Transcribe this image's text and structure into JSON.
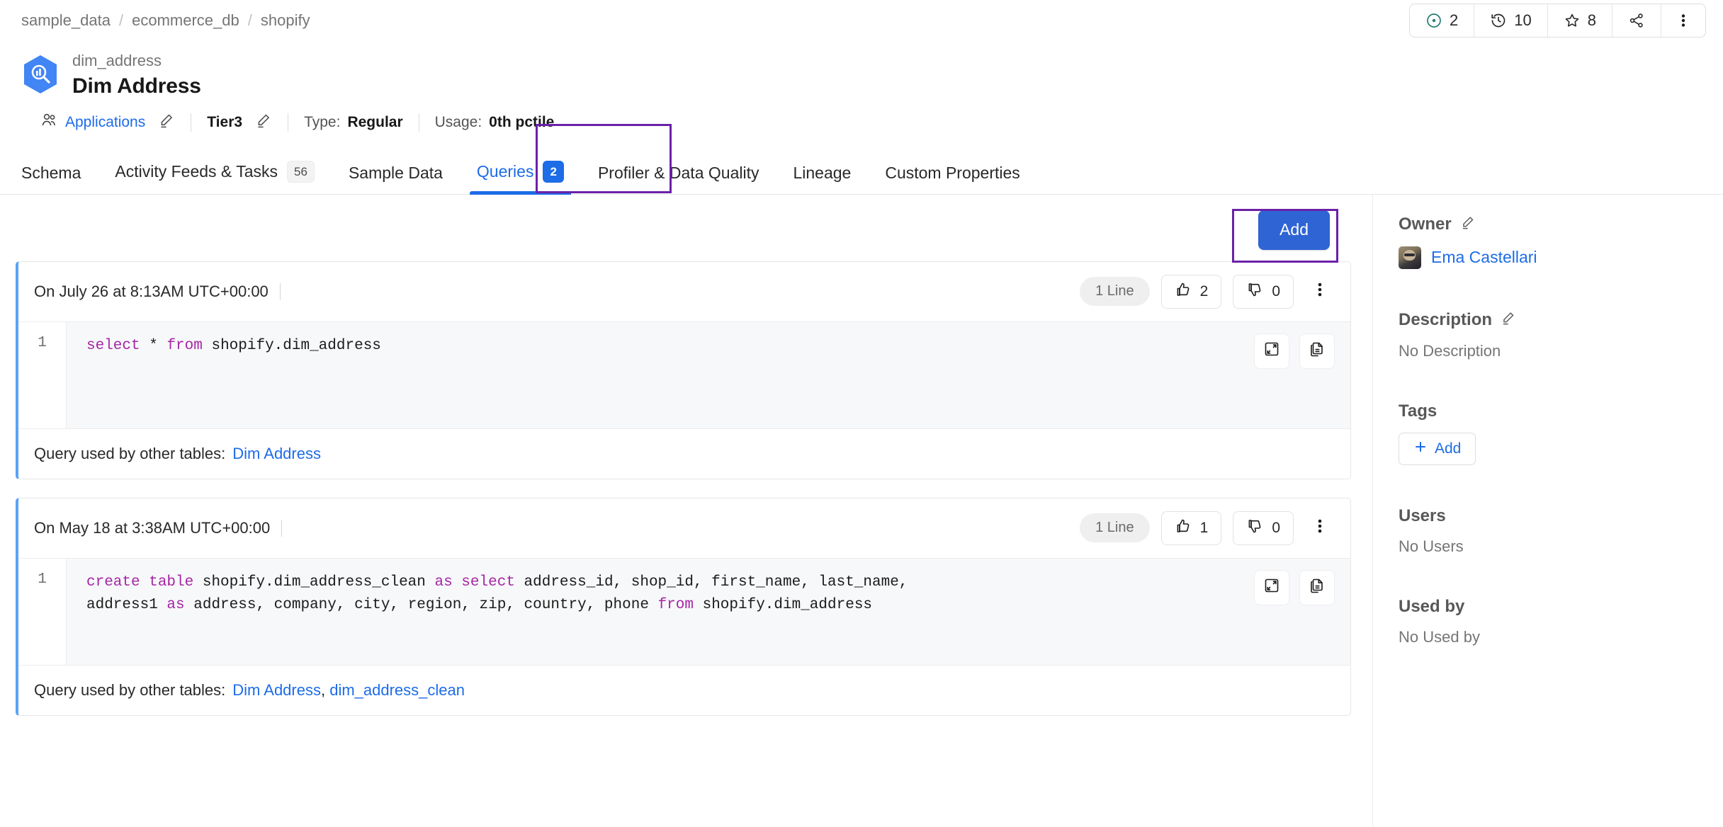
{
  "breadcrumb": {
    "items": [
      "sample_data",
      "ecommerce_db",
      "shopify"
    ],
    "separator": "/"
  },
  "header_actions": {
    "announcement": {
      "icon": "target-icon",
      "count": "2"
    },
    "version": {
      "icon": "history-icon",
      "count": "10"
    },
    "followers": {
      "icon": "star-icon",
      "count": "8"
    },
    "share": {
      "icon": "share-icon"
    },
    "more": {
      "icon": "kebab-menu-icon"
    }
  },
  "entity": {
    "logo_icon": "bigquery-logo-icon",
    "fqn": "dim_address",
    "display_name": "Dim Address",
    "meta": {
      "owner_icon": "team-icon",
      "owner": "Applications",
      "tier": "Tier3",
      "type_label": "Type:",
      "type_value": "Regular",
      "usage_label": "Usage:",
      "usage_value": "0th pctile",
      "edit_icon": "pencil-icon"
    }
  },
  "tabs": [
    {
      "label": "Schema",
      "count": null,
      "active": false
    },
    {
      "label": "Activity Feeds & Tasks",
      "count": "56",
      "active": false
    },
    {
      "label": "Sample Data",
      "count": null,
      "active": false
    },
    {
      "label": "Queries",
      "count": "2",
      "active": true
    },
    {
      "label": "Profiler & Data Quality",
      "count": null,
      "active": false
    },
    {
      "label": "Lineage",
      "count": null,
      "active": false
    },
    {
      "label": "Custom Properties",
      "count": null,
      "active": false
    }
  ],
  "toolbar": {
    "add_label": "Add"
  },
  "queries": [
    {
      "date": "On July 26 at 8:13AM UTC+00:00",
      "lines_badge": "1 Line",
      "upvotes": "2",
      "downvotes": "0",
      "line_number": "1",
      "code_tokens": [
        {
          "t": "select",
          "kw": true
        },
        {
          "t": " * ",
          "kw": false
        },
        {
          "t": "from",
          "kw": true
        },
        {
          "t": " shopify.dim_address",
          "kw": false
        }
      ],
      "used_by_label": "Query used by other tables:",
      "used_by": [
        "Dim Address"
      ],
      "expand_icon": "expand-icon",
      "copy_icon": "copy-icon",
      "more_icon": "kebab-menu-icon",
      "like_icon": "thumbs-up-icon",
      "dislike_icon": "thumbs-down-icon"
    },
    {
      "date": "On May 18 at 3:38AM UTC+00:00",
      "lines_badge": "1 Line",
      "upvotes": "1",
      "downvotes": "0",
      "line_number": "1",
      "code_tokens": [
        {
          "t": "create table",
          "kw": true
        },
        {
          "t": " shopify.dim_address_clean ",
          "kw": false
        },
        {
          "t": "as select",
          "kw": true
        },
        {
          "t": " address_id, shop_id, first_name, last_name,\naddress1 ",
          "kw": false
        },
        {
          "t": "as",
          "kw": true
        },
        {
          "t": " address, company, city, region, zip, country, phone ",
          "kw": false
        },
        {
          "t": "from",
          "kw": true
        },
        {
          "t": " shopify.dim_address",
          "kw": false
        }
      ],
      "used_by_label": "Query used by other tables:",
      "used_by": [
        "Dim Address",
        "dim_address_clean"
      ],
      "expand_icon": "expand-icon",
      "copy_icon": "copy-icon",
      "more_icon": "kebab-menu-icon",
      "like_icon": "thumbs-up-icon",
      "dislike_icon": "thumbs-down-icon"
    }
  ],
  "sidebar": {
    "owner": {
      "title": "Owner",
      "edit_icon": "pencil-icon",
      "name": "Ema Castellari",
      "avatar": "user-avatar"
    },
    "description": {
      "title": "Description",
      "edit_icon": "pencil-icon",
      "value": "No Description"
    },
    "tags": {
      "title": "Tags",
      "add_label": "Add",
      "add_icon": "plus-icon"
    },
    "users": {
      "title": "Users",
      "value": "No Users"
    },
    "used_by": {
      "title": "Used by",
      "value": "No Used by"
    }
  },
  "colors": {
    "accent_blue": "#1d6ce8",
    "button_blue": "#2f64d4",
    "highlight_purple": "#6b21a8",
    "sql_keyword": "#a626a4",
    "card_accent": "#5aa2f7"
  }
}
